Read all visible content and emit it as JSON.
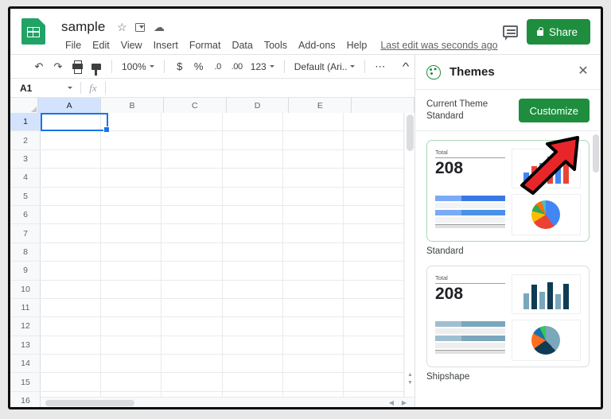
{
  "app": {
    "logo_icon": "sheets-logo-icon",
    "doc_title": "sample",
    "star_icon": "star-icon",
    "move_icon": "move-to-folder-icon",
    "cloud_icon": "cloud-saved-icon",
    "last_edit": "Last edit was seconds ago",
    "comment_icon": "comment-icon",
    "share_label": "Share",
    "share_lock_icon": "lock-icon",
    "accent_green": "#1e8e3e",
    "accent_blue": "#1a73e8"
  },
  "menubar": {
    "items": [
      {
        "label": "File"
      },
      {
        "label": "Edit"
      },
      {
        "label": "View"
      },
      {
        "label": "Insert"
      },
      {
        "label": "Format"
      },
      {
        "label": "Data"
      },
      {
        "label": "Tools"
      },
      {
        "label": "Add-ons"
      },
      {
        "label": "Help"
      }
    ]
  },
  "toolbar": {
    "undo_icon": "undo-icon",
    "redo_icon": "redo-icon",
    "print_icon": "print-icon",
    "paint_format_icon": "paint-format-icon",
    "zoom_value": "100%",
    "currency_label": "$",
    "percent_label": "%",
    "decrease_decimal_label": ".0",
    "increase_decimal_label": ".00",
    "number_format_label": "123",
    "font_name": "Default (Ari...",
    "more_label": "⋯",
    "collapse_icon": "chevron-up-icon"
  },
  "formula_bar": {
    "name_box_value": "A1",
    "fx_label": "fx",
    "formula_value": "",
    "formula_placeholder": ""
  },
  "grid": {
    "columns": [
      "A",
      "B",
      "C",
      "D",
      "E"
    ],
    "rows": [
      "1",
      "2",
      "3",
      "4",
      "5",
      "6",
      "7",
      "8",
      "9",
      "10",
      "11",
      "12",
      "13",
      "14",
      "15",
      "16"
    ],
    "selected_cell": "A1",
    "cells": []
  },
  "sidebar": {
    "title": "Themes",
    "palette_icon": "palette-icon",
    "close_icon": "close-icon",
    "current_theme_caption": "Current Theme",
    "current_theme_name": "Standard",
    "customize_label": "Customize",
    "themes": [
      {
        "name": "Standard",
        "selected": true,
        "kpi_label": "Total",
        "kpi_value": "208",
        "bar_colors": [
          "#4285f4",
          "#ea4335",
          "#4285f4",
          "#ea4335",
          "#4285f4",
          "#ea4335"
        ],
        "bar_heights": [
          14,
          22,
          26,
          34,
          23,
          33
        ],
        "table_colors": [
          "#7baaf7",
          "#3b78e7",
          "#f1f3f4",
          "#ffffff",
          "#7baaf7",
          "#4a90e8",
          "#f1f3f4",
          "#ffffff"
        ],
        "pie_colors": [
          "#4285f4",
          "#ea4335",
          "#fbbc04",
          "#34a853",
          "#ff6d01",
          "#46bdc6"
        ]
      },
      {
        "name": "Shipshape",
        "selected": false,
        "kpi_label": "Total",
        "kpi_value": "208",
        "bar_colors": [
          "#7ba7bc",
          "#0f3b54",
          "#7ba7bc",
          "#0f3b54",
          "#7ba7bc",
          "#0f3b54"
        ],
        "bar_heights": [
          20,
          31,
          22,
          34,
          19,
          32
        ],
        "table_colors": [
          "#9ebfd0",
          "#7ba7bc",
          "#eeeeee",
          "#ffffff",
          "#9ebfd0",
          "#7ba7bc",
          "#eeeeee",
          "#ffffff"
        ],
        "pie_colors": [
          "#7ba7bc",
          "#0f3b54",
          "#ff6d1f",
          "#1a73a8",
          "#34c759"
        ]
      }
    ]
  },
  "annotation": {
    "arrow_icon": "red-arrow-annotation",
    "arrow_color": "#e8262a",
    "arrow_outline": "#000000"
  }
}
